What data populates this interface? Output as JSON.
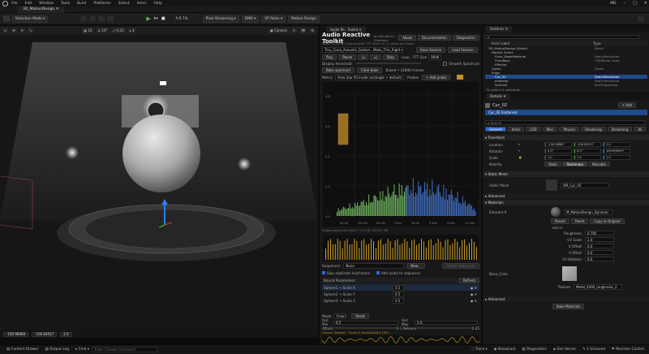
{
  "menubar": {
    "items": [
      "File",
      "Edit",
      "Window",
      "Tools",
      "Build",
      "Platforms",
      "Select",
      "Actor",
      "Help"
    ],
    "project": "MD"
  },
  "tab": {
    "label": "3D_MotionDesign"
  },
  "toolbar": {
    "selection_mode": "Selection Mode",
    "pixel_streaming": "Pixel Streaming",
    "dmx": "DMX",
    "vp_roles": "VP Roles",
    "motion_design": "Motion Design",
    "artk": "A.R.T.K."
  },
  "viewport": {
    "camera": "Camera",
    "grid": "10",
    "angle": "10°",
    "scale": "0.25",
    "speed": "4",
    "coords": [
      "-100 98968",
      "-100 82017",
      "2.0"
    ]
  },
  "statusbar": {
    "content_drawer": "Content Drawer",
    "output_log": "Output Log",
    "cmd": "Cmd",
    "cmd_placeholder": "Enter Console Command",
    "trace": "Trace",
    "broadcast": "Broadcast",
    "diagnostics": "Diagnostics",
    "zen_server": "Zen Server",
    "unsaved": "1 Unsaved",
    "revision_control": "Revision Control"
  },
  "toolkit": {
    "tab": "Audio Re.. Toolkit",
    "title": "Audio Reactive Toolkit",
    "by": "by Wonderful Creations",
    "buttons": {
      "about": "About",
      "documentation": "Documentation",
      "diagnostics": "Diagnostics"
    },
    "version": "WAVE v1.22 (b) | Deprecated: FFT Style 15 | 3 nodes per frame",
    "file": "Tiny_Cisco_Acoustic_Guitars...Make_This_Right-drama_fluid_01 Action FX3",
    "save_session": "Save Session",
    "load_session": "Load Session",
    "transport": {
      "play": "Play",
      "pause": "Pause",
      "stop": "Stop",
      "loop": "Loop",
      "fps": "FFT Size",
      "fps_val": "8096"
    },
    "smooth_spectrum": "Smooth Spectrum",
    "display_threshold": "Display threshold",
    "bake_spectrum": "Bake spectrum",
    "clear_bake": "Clear bake",
    "baked_info": "Baked • 14896 frames",
    "metric_label": "Metric",
    "metric": "Area (bar fill inside rectangle + default)",
    "probes": "Probes",
    "add_probe": "+ Add probe",
    "x_ticks": [
      "40 Hz",
      "100 Hz",
      "250 Hz",
      "1 kHz",
      "3k Hz",
      "5 kHz",
      "9 kHz",
      "15 kHz"
    ],
    "y_ticks": [
      "0.8",
      "0.6",
      "0.4",
      "0.2",
      "0.0"
    ],
    "probe_caption": "Probe output over time (~10 s @ 120 Hz: 16)",
    "sequencer_label": "Sequencer",
    "sequencer_value": "None",
    "new": "New...",
    "add_to_sequencer": "Add to Sequencer",
    "skip_duplicate": "Skip duplicate keyframes",
    "add_audio": "Add audio to sequence",
    "bound_params": "Bound Parameters",
    "refresh": "Refresh",
    "params": [
      {
        "name": "Sphere1 → Scale X",
        "val": "0.5"
      },
      {
        "name": "Sphere2 → Scale Y",
        "val": "0.5"
      },
      {
        "name": "Sphere3 → Scale Z",
        "val": "0.5"
      }
    ],
    "mode_label": "Mode",
    "mode_value": "Clean",
    "reset": "Reset",
    "out_min": "Out Min",
    "out_min_val": "0.5",
    "out_max": "Out Max",
    "out_max_val": "2.0",
    "attack": "Attack",
    "attack_val": "0.1",
    "release": "Release",
    "release_val": "0.25",
    "output_caption": "Output: Sphere1 · Scale X (normalized 0-100)"
  },
  "outliner": {
    "tab": "Outliner",
    "col_label": "Item Label",
    "col_type": "Type",
    "rows": [
      {
        "label": "3D_MotionDesign (Editor)",
        "type": "World"
      },
      {
        "label": "Default Scene",
        "type": ""
      },
      {
        "label": "Floor_ModelMaterial",
        "type": "StaticMeshActor"
      },
      {
        "label": "FloorBase",
        "type": "CEEffector Actor"
      },
      {
        "label": "Effector",
        "type": ""
      },
      {
        "label": "Lights",
        "type": "Folder"
      },
      {
        "label": "Props",
        "type": ""
      },
      {
        "label": "Cyc_02",
        "type": "StaticMeshActor"
      },
      {
        "label": "pedestal",
        "type": "StaticMeshActor"
      },
      {
        "label": "Sphere1",
        "type": "AvaShapeActor"
      }
    ],
    "footer": "74 actors (1 selected)"
  },
  "details": {
    "tab": "Details",
    "actor": "Cyc_02",
    "add": "+ Add",
    "instance": "Cyc_02 (Instance)",
    "search": "Search",
    "filters": [
      "General",
      "Actor",
      "LOD",
      "Misc",
      "Physics",
      "Rendering",
      "Streaming",
      "All"
    ],
    "transform": "Transform",
    "location": {
      "label": "Location",
      "x": "-100.98967",
      "y": "-100.82017",
      "z": "2.0"
    },
    "rotation": {
      "label": "Rotation",
      "x": "0.0°",
      "y": "0.0°",
      "z": "-89.999999°"
    },
    "scale": {
      "label": "Scale",
      "x": "1.0",
      "y": "1.0",
      "z": "1.0"
    },
    "mobility": {
      "label": "Mobility",
      "static": "Static",
      "stationary": "Stationary",
      "movable": "Movable"
    },
    "static_mesh_section": "Static Mesh",
    "static_mesh_label": "Static Mesh",
    "static_mesh_value": "SM_Cyc_02",
    "advanced": "Advanced",
    "materials": "Materials",
    "element0": "Element 0",
    "material_value": "M_MotionDesign_Dynamic",
    "revert": "Revert",
    "reset": "Reset",
    "copy_to_original": "Copy to Original",
    "mat_group": "MAT1P",
    "roughness": {
      "label": "Roughness",
      "val": "0.785"
    },
    "uv_scale": {
      "label": "UV Scale",
      "val": "1.0"
    },
    "u_offset": {
      "label": "U Offset",
      "val": "0.0"
    },
    "v_offset": {
      "label": "V Offset",
      "val": "0.0"
    },
    "uv_rotation": {
      "label": "UV Rotation",
      "val": "0.0"
    },
    "base_color": "Base_Color",
    "texture_label": "Texture",
    "texture_value": "Metal_4000_roughness_2",
    "advanced2": "Advanced",
    "bake_materials": "Bake Materials"
  },
  "colors": {
    "accent": "#2d6ad6",
    "play": "#5bc04a",
    "spectrum_green": "#7fd36b",
    "spectrum_blue": "#4a7fe0",
    "waveform": "#d4a32a"
  }
}
